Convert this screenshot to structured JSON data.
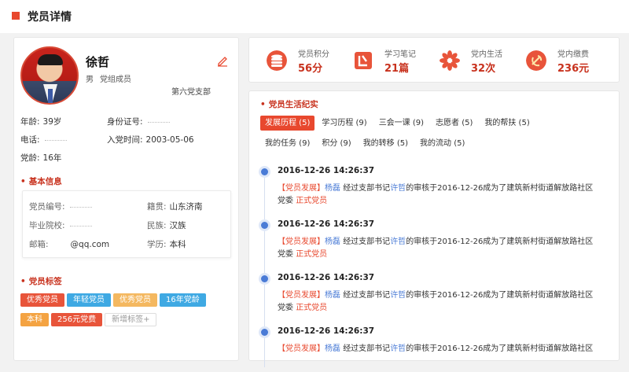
{
  "header": {
    "title": "党员详情"
  },
  "profile": {
    "name": "徐哲",
    "gender": "男",
    "role": "党组成员",
    "branch": "第六党支部",
    "age_label": "年龄:",
    "age": "39岁",
    "id_label": "身份证号:",
    "id_value": "",
    "phone_label": "电话:",
    "phone_value": "",
    "join_label": "入党时间:",
    "join_date": "2003-05-06",
    "party_age_label": "党龄:",
    "party_age": "16年"
  },
  "basic": {
    "title": "基本信息",
    "member_no_label": "党员编号:",
    "member_no": "",
    "native_label": "籍贯:",
    "native": "山东济南",
    "school_label": "毕业院校:",
    "school": "",
    "ethnic_label": "民族:",
    "ethnic": "汉族",
    "email_label": "邮箱:",
    "email": "@qq.com",
    "edu_label": "学历:",
    "edu": "本科"
  },
  "tags": {
    "title": "党员标签",
    "items": [
      {
        "label": "优秀党员",
        "color": "#e8543a"
      },
      {
        "label": "年轻党员",
        "color": "#3fa9e3"
      },
      {
        "label": "优秀党员",
        "color": "#f4b860"
      },
      {
        "label": "16年党龄",
        "color": "#3fa9e3"
      },
      {
        "label": "本科",
        "color": "#f4a342"
      },
      {
        "label": "256元党费",
        "color": "#e8543a"
      }
    ],
    "add_label": "新增标签+"
  },
  "stats": [
    {
      "label": "党员积分",
      "value": "56分",
      "icon": "coins-icon"
    },
    {
      "label": "学习笔记",
      "value": "21篇",
      "icon": "notebook-icon"
    },
    {
      "label": "党内生活",
      "value": "32次",
      "icon": "flower-icon"
    },
    {
      "label": "党内缴费",
      "value": "236元",
      "icon": "party-emblem-icon"
    }
  ],
  "life": {
    "title": "党员生活纪实",
    "tabs": [
      {
        "label": "发展历程 (5)",
        "active": true
      },
      {
        "label": "学习历程 (9)"
      },
      {
        "label": "三会一课 (9)"
      },
      {
        "label": "志愿者 (5)"
      },
      {
        "label": "我的帮扶 (5)"
      },
      {
        "label": "我的任务 (9)"
      },
      {
        "label": "积分 (9)"
      },
      {
        "label": "我的转移 (5)"
      },
      {
        "label": "我的流动 (5)"
      }
    ],
    "events": [
      {
        "time": "2016-12-26  14:26:37",
        "tag": "【党员发展】",
        "who": "杨磊",
        "mid1": "经过支部书记",
        "secretary": "许哲",
        "mid2": "的审核于2016-12-26成为了建筑新村街道解放路社区党委",
        "status": "正式党员"
      },
      {
        "time": "2016-12-26  14:26:37",
        "tag": "【党员发展】",
        "who": "杨磊",
        "mid1": "经过支部书记",
        "secretary": "许哲",
        "mid2": "的审核于2016-12-26成为了建筑新村街道解放路社区党委",
        "status": "正式党员"
      },
      {
        "time": "2016-12-26  14:26:37",
        "tag": "【党员发展】",
        "who": "杨磊",
        "mid1": "经过支部书记",
        "secretary": "许哲",
        "mid2": "的审核于2016-12-26成为了建筑新村街道解放路社区党委",
        "status": "正式党员"
      },
      {
        "time": "2016-12-26  14:26:37",
        "tag": "【党员发展】",
        "who": "杨磊",
        "mid1": "经过支部书记",
        "secretary": "许哲",
        "mid2": "的审核于2016-12-26成为了建筑新村街道解放路社区",
        "status": ""
      }
    ]
  }
}
